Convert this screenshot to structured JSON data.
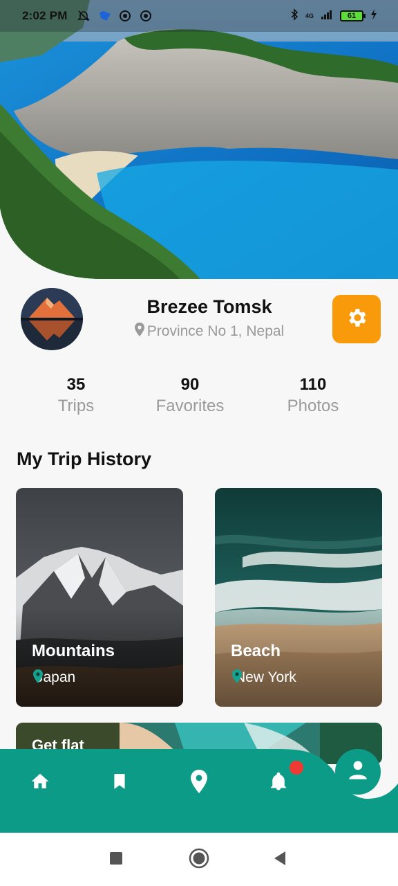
{
  "status_bar": {
    "time": "2:02 PM",
    "network": "4G",
    "battery": "61"
  },
  "profile": {
    "name": "Brezee Tomsk",
    "location": "Province No 1, Nepal"
  },
  "stats": [
    {
      "value": "35",
      "label": "Trips"
    },
    {
      "value": "90",
      "label": "Favorites"
    },
    {
      "value": "110",
      "label": "Photos"
    }
  ],
  "trip_history": {
    "title": "My Trip History",
    "cards": [
      {
        "title": "Mountains",
        "location": "Japan"
      },
      {
        "title": "Beach",
        "location": "New York"
      }
    ],
    "promo_text": "Get flat"
  },
  "colors": {
    "accent_orange": "#f89a0a",
    "teal": "#0c9b87",
    "badge_red": "#ee3a33"
  },
  "bottom_nav": {
    "icons": [
      "home-icon",
      "bookmark-icon",
      "location-pin-icon",
      "bell-icon",
      "person-icon"
    ],
    "notification_badge": true
  },
  "system_nav": {
    "icons": [
      "recents-square-icon",
      "home-circle-icon",
      "back-triangle-icon"
    ]
  }
}
